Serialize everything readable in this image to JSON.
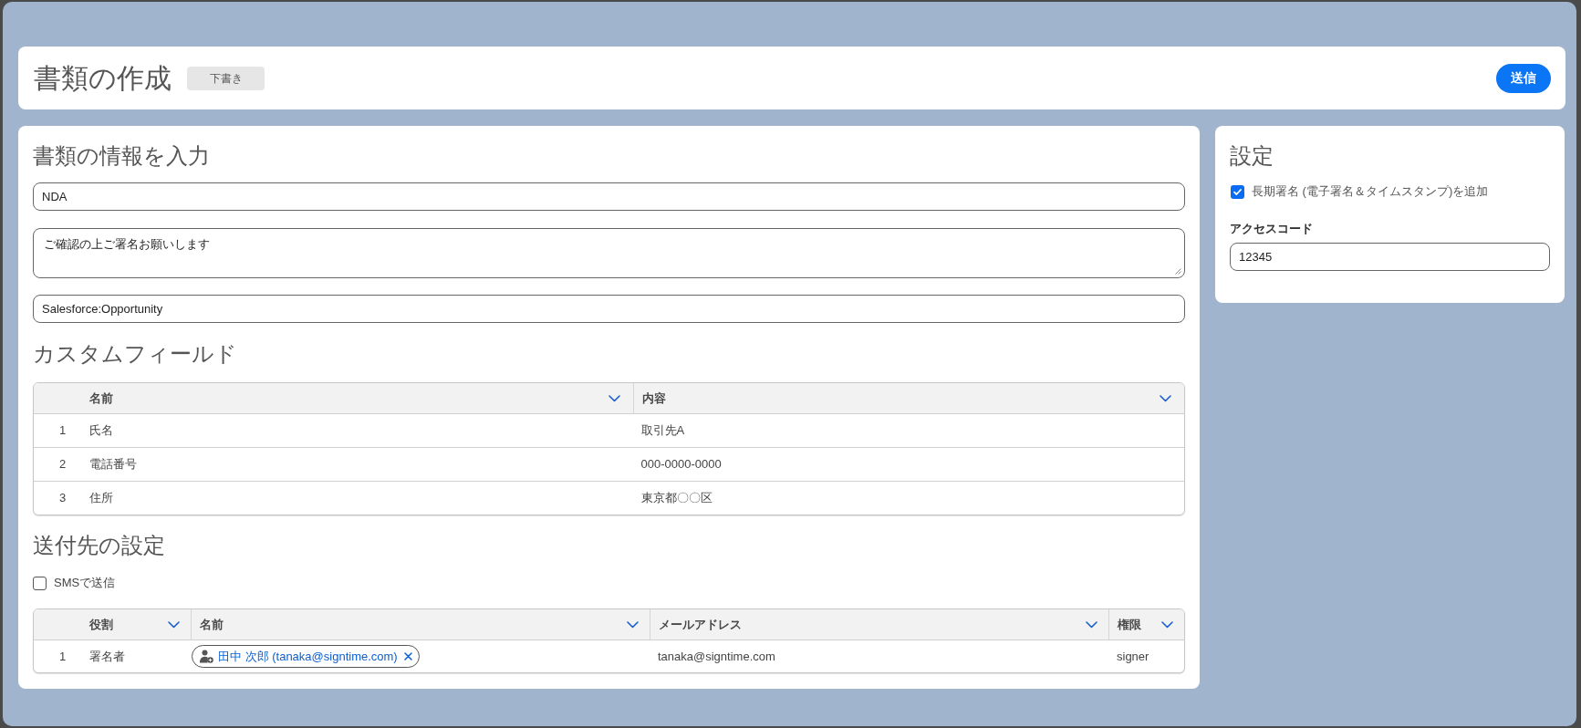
{
  "header": {
    "title": "書類の作成",
    "status": "下書き",
    "send_button": "送信"
  },
  "document_info": {
    "heading": "書類の情報を入力",
    "title_field": {
      "value": "NDA"
    },
    "message_field": {
      "value": "ご確認の上ご署名お願いします"
    },
    "reference_field": {
      "value": "Salesforce:Opportunity"
    }
  },
  "custom_fields": {
    "heading": "カスタムフィールド",
    "columns": [
      {
        "label": "名前"
      },
      {
        "label": "内容"
      }
    ],
    "rows": [
      {
        "index": "1",
        "name": "氏名",
        "value": "取引先A"
      },
      {
        "index": "2",
        "name": "電話番号",
        "value": "000-0000-0000"
      },
      {
        "index": "3",
        "name": "住所",
        "value": "東京都〇〇区"
      }
    ]
  },
  "recipients": {
    "heading": "送付先の設定",
    "sms": {
      "label": "SMSで送信",
      "checked": false
    },
    "columns": [
      {
        "label": "役割"
      },
      {
        "label": "名前"
      },
      {
        "label": "メールアドレス"
      },
      {
        "label": "権限"
      }
    ],
    "rows": [
      {
        "index": "1",
        "role": "署名者",
        "name": "田中 次郎 (tanaka@signtime.com)",
        "email": "tanaka@signtime.com",
        "permission": "signer"
      }
    ]
  },
  "settings": {
    "heading": "設定",
    "long_term_signature": {
      "label": "長期署名 (電子署名＆タイムスタンプ)を追加",
      "checked": true
    },
    "access_code": {
      "label": "アクセスコード",
      "value": "12345"
    }
  }
}
